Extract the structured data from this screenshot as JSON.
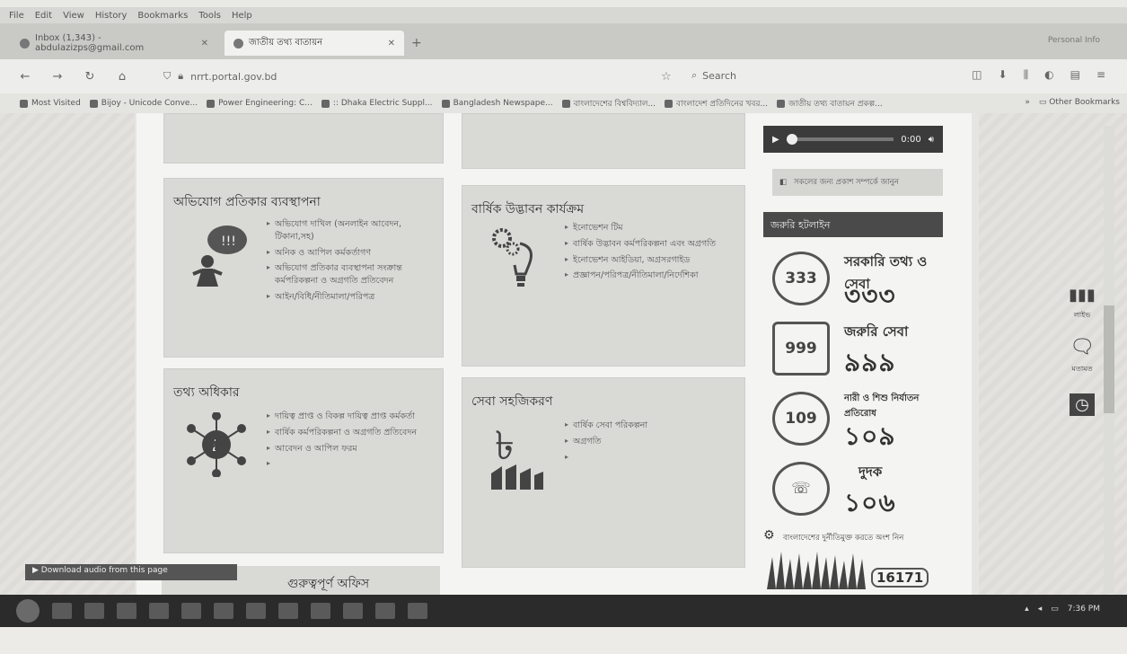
{
  "menubar": [
    "File",
    "Edit",
    "View",
    "History",
    "Bookmarks",
    "Tools",
    "Help"
  ],
  "tabs": [
    {
      "label": "Inbox (1,343) - abdulazizps@gmail.com",
      "active": false
    },
    {
      "label": "জাতীয় তথ্য বাতায়ন",
      "active": true
    }
  ],
  "tab_right_meta": "Personal Info",
  "navbar": {
    "url": "nrrt.portal.gov.bd",
    "search_placeholder": "Search"
  },
  "bookmarks": [
    "Most Visited",
    "Bijoy - Unicode Conve...",
    "Power Engineering: C...",
    ":: Dhaka Electric Suppl...",
    "Bangladesh Newspape...",
    "বাংলাদেশের বিশ্ববিদ্যাল...",
    "বাংলাদেশ প্রতিদিনের খবর...",
    "জাতীয় তথ্য বাতায়ন প্রকল্প..."
  ],
  "bookmarks_overflow": "»",
  "other_bookmarks": "Other Bookmarks",
  "cards": [
    {
      "title": "অভিযোগ প্রতিকার ব্যবস্থাপনা",
      "items": [
        "অভিযোগ দাখিল (অনলাইন আবেদন, টিকানা,সহ)",
        "অনিক ও আপিল কর্মকর্তাগণ",
        "অভিযোগ প্রতিকার ব্যবস্থাপনা সংক্রান্ত কর্মপরিকল্পনা ও অগ্রগতি প্রতিবেদন",
        "আইন/বিধি/নীতিমালা/পরিপত্র"
      ]
    },
    {
      "title": "বার্ষিক উদ্ভাবন কার্যক্রম",
      "items": [
        "ইনোভেশন টিম",
        "বার্ষিক উদ্ভাবন কর্মপরিকল্পনা এবং অগ্রগতি",
        "ইনোভেশন আইডিয়া, অগ্রসরগাইড",
        "প্রজ্ঞাপন/পরিপত্র/নীতিমালা/নির্দেশিকা"
      ]
    },
    {
      "title": "তথ্য অধিকার",
      "items": [
        "দায়িত্ব প্রাপ্ত ও বিকল্প দায়িত্ব প্রাপ্ত কর্মকর্তা",
        "বার্ষিক কর্মপরিকল্পনা ও অগ্রগতি প্রতিবেদন",
        "আবেদন ও আপিল ফরম",
        ""
      ]
    },
    {
      "title": "সেবা সহজিকরণ",
      "items": [
        "বার্ষিক সেবা পরিকল্পনা",
        "অগ্রগতি",
        ""
      ]
    }
  ],
  "audio": {
    "time": "0:00"
  },
  "read_aloud_label": "সকলের জন্য প্রকাশ সম্পর্কে জানুন",
  "hotline_header": "জরুরি হটলাইন",
  "hotlines": [
    {
      "logo": "333",
      "title": "সরকারি তথ্য ও সেবা",
      "number": "৩৩৩"
    },
    {
      "logo": "999",
      "title": "জরুরি সেবা",
      "number": "৯৯৯"
    },
    {
      "logo": "109",
      "title": "নারী ও শিশু নির্যাতন প্রতিরোধ",
      "number": "১০৯"
    },
    {
      "logo": "",
      "title": "দুদক",
      "number": "১০৬"
    }
  ],
  "hotline_last": {
    "caption": "বাংলাদেশের দুর্নীতিমুক্ত করতে অংশ নিন",
    "number": "16171"
  },
  "floatbar": [
    "লাইভ",
    "মতামত"
  ],
  "download_link": "Download audio from this page",
  "next_card_title": "গুরুত্বপূর্ণ অফিস",
  "tray_clock": "7:36 PM",
  "colors": {
    "accent": "#4a4a4a",
    "bg": "#e6e5e1"
  }
}
